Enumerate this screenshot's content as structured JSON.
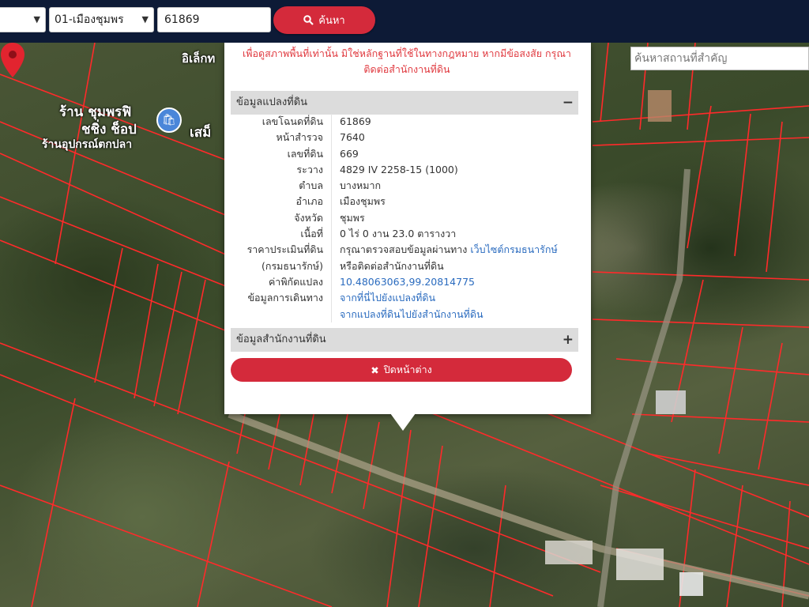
{
  "topbar": {
    "district_select": "01-เมืองชุมพร",
    "deed_input_value": "61869",
    "search_button": "ค้นหา"
  },
  "map": {
    "place_search_placeholder": "ค้นหาสถานที่สำคัญ",
    "labels": {
      "shop_name_1": "ร้าน ชุมพรฟิ",
      "shop_name_2": "ชชิ่ง ช็อป",
      "shop_name_3": "ร้านอุปกรณ์ตกปลา",
      "partial_top": "อิเล็กท",
      "partial_mid": "เสม็"
    }
  },
  "popup": {
    "warning_line1": "เพื่อดูสภาพพื้นที่เท่านั้น มิใช่หลักฐานที่ใช้ในทางกฎหมาย หากมีข้อสงสัย กรุณา",
    "warning_line2": "ติดต่อสำนักงานที่ดิน",
    "section_parcel": "ข้อมูลแปลงที่ดิน",
    "section_office": "ข้อมูลสำนักงานที่ดิน",
    "rows": [
      {
        "label": "เลขโฉนดที่ดิน",
        "value": "61869"
      },
      {
        "label": "หน้าสำรวจ",
        "value": "7640"
      },
      {
        "label": "เลขที่ดิน",
        "value": "669"
      },
      {
        "label": "ระวาง",
        "value": "4829 IV 2258-15 (1000)"
      },
      {
        "label": "ตำบล",
        "value": "บางหมาก"
      },
      {
        "label": "อำเภอ",
        "value": "เมืองชุมพร"
      },
      {
        "label": "จังหวัด",
        "value": "ชุมพร"
      },
      {
        "label": "เนื้อที่",
        "value": "0 ไร่ 0 งาน 23.0 ตารางวา"
      }
    ],
    "appraisal_label_1": "ราคาประเมินที่ดิน",
    "appraisal_label_2": "(กรมธนารักษ์)",
    "appraisal_text_1": "กรุณาตรวจสอบข้อมูลผ่านทาง",
    "appraisal_link": "เว็บไซต์กรมธนารักษ์",
    "appraisal_text_2": "หรือติดต่อสำนักงานที่ดิน",
    "coord_label": "ค่าพิกัดแปลง",
    "coord_value": "10.48063063,99.20814775",
    "travel_label": "ข้อมูลการเดินทาง",
    "travel_link_1": "จากที่นี่ไปยังแปลงที่ดิน",
    "travel_link_2": "จากแปลงที่ดินไปยังสำนักงานที่ดิน",
    "close_button": "ปิดหน้าต่าง"
  },
  "colors": {
    "topbar": "#0d1a36",
    "accent_red": "#d42a3b",
    "parcel_line": "#ff2222",
    "link": "#2a6bbf"
  },
  "icons": [
    "search-icon",
    "times-icon",
    "minus-icon",
    "plus-icon",
    "shopping-bag-icon",
    "map-marker-icon",
    "chevron-down-icon"
  ]
}
